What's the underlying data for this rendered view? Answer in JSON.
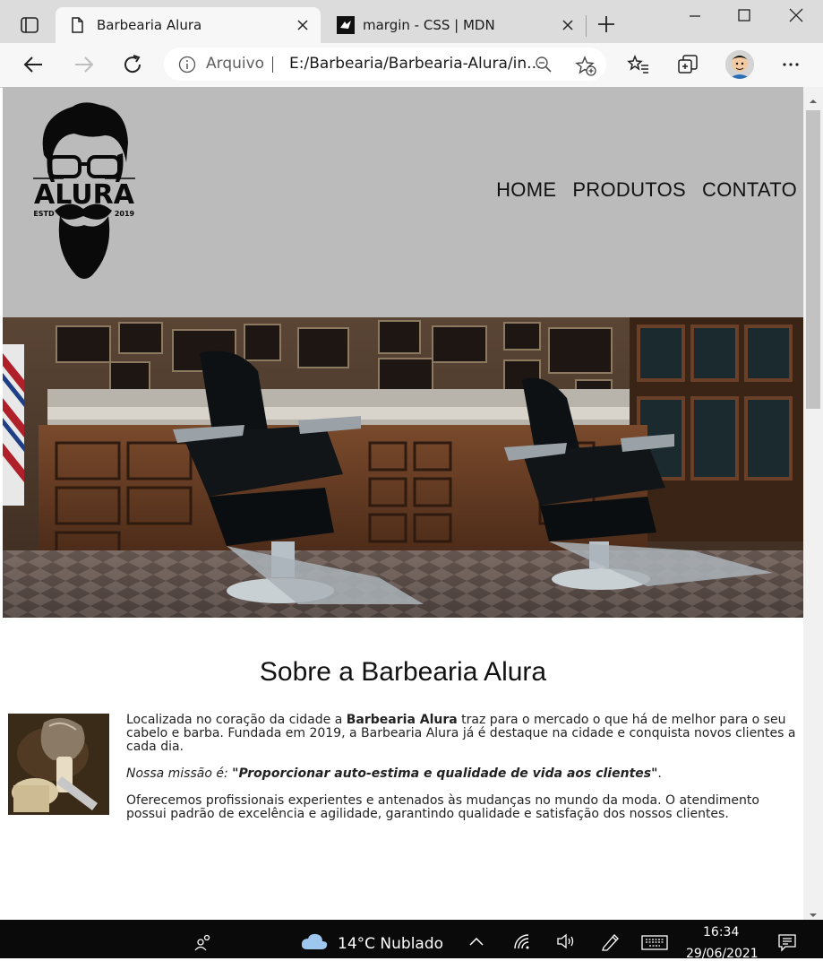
{
  "browser": {
    "tabs": [
      {
        "title": "Barbearia Alura",
        "active": true
      },
      {
        "title": "margin - CSS | MDN",
        "active": false
      }
    ],
    "address": {
      "label": "Arquivo",
      "url": "E:/Barbearia/Barbearia-Alura/in..."
    }
  },
  "site": {
    "logo": {
      "brand": "ALURA",
      "estd": "ESTD",
      "year": "2019"
    },
    "nav": [
      "HOME",
      "PRODUTOS",
      "CONTATO"
    ],
    "about": {
      "title": "Sobre a Barbearia Alura",
      "p1_before": "Localizada no coração da cidade a ",
      "p1_bold": "Barbearia Alura",
      "p1_after": " traz para o mercado o que há de melhor para o seu cabelo e barba. Fundada em 2019, a Barbearia Alura já é destaque na cidade e conquista novos clientes a cada dia.",
      "mission_label": "Nossa missão é: ",
      "mission_quote": "\"Proporcionar auto-estima e qualidade de vida aos clientes\"",
      "mission_end": ".",
      "p3": "Oferecemos profissionais experientes e antenados às mudanças no mundo da moda. O atendimento possui padrão de excelência e agilidade, garantindo qualidade e satisfação dos nossos clientes."
    }
  },
  "taskbar": {
    "weather": "14°C  Nublado",
    "time": "16:34",
    "date": "29/06/2021"
  },
  "colors": {
    "header_bg": "#bbbbbb",
    "tabbar_bg": "#dcdcdc",
    "taskbar_bg": "#0a0a0a"
  }
}
